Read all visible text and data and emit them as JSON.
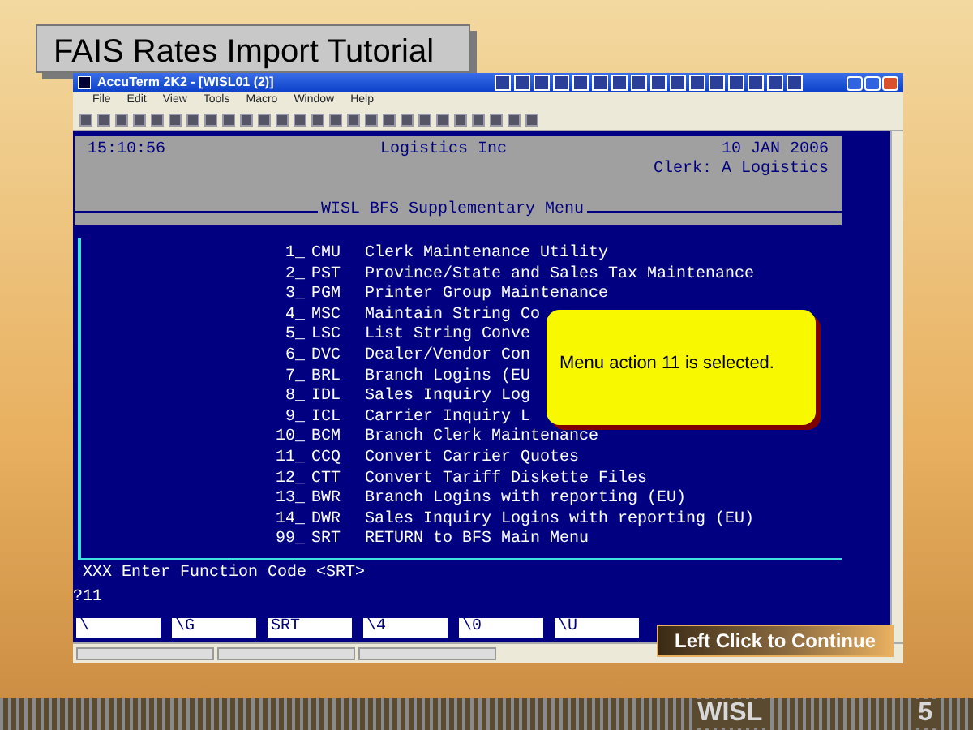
{
  "slide": {
    "title": "FAIS Rates Import Tutorial",
    "footer_logo": "WISL",
    "page_number": "5"
  },
  "window": {
    "title": "AccuTerm 2K2 - [WISL01 (2)]",
    "menu": [
      "File",
      "Edit",
      "View",
      "Tools",
      "Macro",
      "Window",
      "Help"
    ]
  },
  "terminal": {
    "time": "15:10:56",
    "company": "Logistics Inc",
    "date": "10 JAN 2006",
    "clerk": "Clerk: A Logistics",
    "menu_title": "WISL BFS Supplementary Menu",
    "items": [
      {
        "number": "1_",
        "code": "CMU",
        "label": "Clerk Maintenance Utility"
      },
      {
        "number": "2_",
        "code": "PST",
        "label": "Province/State and Sales Tax Maintenance"
      },
      {
        "number": "3_",
        "code": "PGM",
        "label": "Printer Group Maintenance"
      },
      {
        "number": "4_",
        "code": "MSC",
        "label": "Maintain String Co"
      },
      {
        "number": "5_",
        "code": "LSC",
        "label": "List String Conve"
      },
      {
        "number": "6_",
        "code": "DVC",
        "label": "Dealer/Vendor Con"
      },
      {
        "number": "7_",
        "code": "BRL",
        "label": "Branch Logins (EU"
      },
      {
        "number": "8_",
        "code": "IDL",
        "label": "Sales Inquiry Log"
      },
      {
        "number": "9_",
        "code": "ICL",
        "label": "Carrier Inquiry L"
      },
      {
        "number": "10_",
        "code": "BCM",
        "label": "Branch Clerk Maintenance"
      },
      {
        "number": "11_",
        "code": "CCQ",
        "label": "Convert Carrier Quotes"
      },
      {
        "number": "12_",
        "code": "CTT",
        "label": "Convert Tariff Diskette Files"
      },
      {
        "number": "13_",
        "code": "BWR",
        "label": "Branch Logins with reporting (EU)"
      },
      {
        "number": "14_",
        "code": "DWR",
        "label": "Sales Inquiry Logins with reporting (EU)"
      },
      {
        "number": "99_",
        "code": "SRT",
        "label": "RETURN to BFS Main Menu"
      }
    ],
    "prompt": "XXX Enter Function Code <SRT>",
    "input": "?11",
    "function_keys": [
      "\\",
      "\\G",
      "SRT",
      "\\4",
      "\\0",
      "\\U"
    ]
  },
  "callout": {
    "text": "Menu action 11 is selected."
  },
  "continue_button": {
    "label": "Left Click to Continue"
  }
}
